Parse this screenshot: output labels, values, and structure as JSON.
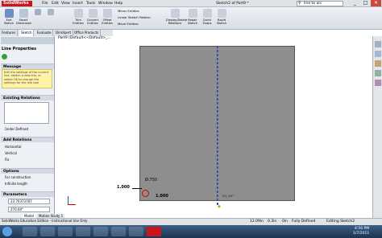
{
  "app": {
    "logo": "SolidWorks",
    "document_title": "Sketch2 of Part9 *"
  },
  "menu": [
    "File",
    "Edit",
    "View",
    "Insert",
    "Tools",
    "Window",
    "Help"
  ],
  "search": {
    "value": "line to arc"
  },
  "window_buttons": [
    "_",
    "□",
    "✕"
  ],
  "toolbar": {
    "tools": [
      "Exit Sketch",
      "Smart Dimension",
      "",
      "",
      "Trim Entities",
      "Convert Entities",
      "Offset Entities"
    ],
    "small_commands": [
      "Mirror Entities",
      "Linear Sketch Pattern",
      "Move Entities"
    ],
    "right_tools": [
      "Display/Delete Relations",
      "Repair Sketch",
      "Quick Snaps",
      "Rapid Sketch"
    ]
  },
  "tabs": [
    "Features",
    "Sketch",
    "Evaluate",
    "DimXpert",
    "Office Products"
  ],
  "tree": {
    "item": "Part9 (Default<<Default>_..."
  },
  "property_manager": {
    "title": "Line Properties",
    "message_header": "Message",
    "message_text": "Edit the settings of the current line, sketch a new line, or select OK to change the settings for the line tool",
    "existing_relations_header": "Existing Relations",
    "under_defined": "Under Defined",
    "add_relations_header": "Add Relations",
    "relations": [
      "Horizontal",
      "Vertical",
      "Fix"
    ],
    "options_header": "Options",
    "options": [
      "For construction",
      "Infinite length"
    ],
    "parameters_header": "Parameters",
    "param_length": "23.70373767",
    "param_angle": "270.00°"
  },
  "canvas": {
    "dim_left": "1.000",
    "dim_radius": "Ø.750",
    "dim_bottom": "1.000",
    "center_label": "(0,0)",
    "angle_label": "D1_90°"
  },
  "bottom_tabs": [
    "Model",
    "Motion Study 1"
  ],
  "status": {
    "edition": "SolidWorks Education Edition - Instructional Use Only",
    "coord1": "12.09in",
    "coord2": "0.3in",
    "coord3": "0in",
    "state": "Fully Defined",
    "editing": "Editing Sketch2"
  },
  "taskbar": {
    "time": "4:56 PM",
    "date": "1/7/2011"
  }
}
